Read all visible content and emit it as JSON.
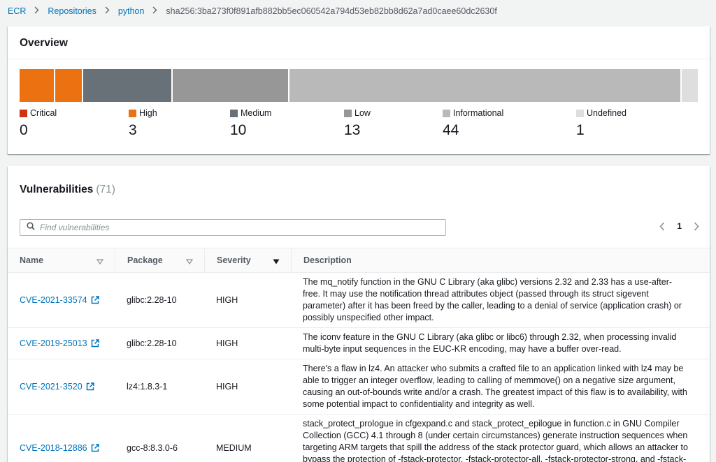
{
  "breadcrumb": {
    "items": [
      "ECR",
      "Repositories",
      "python"
    ],
    "current": "sha256:3ba273f0f891afb882bb5ec060542a794d53eb82bb8d62a7ad0caee60dc2630f"
  },
  "overview": {
    "title": "Overview",
    "segments": [
      {
        "label": "Critical",
        "count": "0",
        "color": "#d13212"
      },
      {
        "label": "High",
        "count": "3",
        "color": "#ec7211"
      },
      {
        "label": "Medium",
        "count": "10",
        "color": "#687078"
      },
      {
        "label": "Low",
        "count": "13",
        "color": "#979797"
      },
      {
        "label": "Informational",
        "count": "44",
        "color": "#b9b9b9"
      },
      {
        "label": "Undefined",
        "count": "1",
        "color": "#dedede"
      }
    ]
  },
  "vulnerabilities": {
    "title": "Vulnerabilities",
    "count": "(71)",
    "search_placeholder": "Find vulnerabilities",
    "page": "1",
    "columns": {
      "name": "Name",
      "package": "Package",
      "severity": "Severity",
      "description": "Description"
    },
    "rows": [
      {
        "name": "CVE-2021-33574",
        "package": "glibc:2.28-10",
        "severity": "HIGH",
        "description": "The mq_notify function in the GNU C Library (aka glibc) versions 2.32 and 2.33 has a use-after-free. It may use the notification thread attributes object (passed through its struct sigevent parameter) after it has been freed by the caller, leading to a denial of service (application crash) or possibly unspecified other impact."
      },
      {
        "name": "CVE-2019-25013",
        "package": "glibc:2.28-10",
        "severity": "HIGH",
        "description": "The iconv feature in the GNU C Library (aka glibc or libc6) through 2.32, when processing invalid multi-byte input sequences in the EUC-KR encoding, may have a buffer over-read."
      },
      {
        "name": "CVE-2021-3520",
        "package": "lz4:1.8.3-1",
        "severity": "HIGH",
        "description": "There's a flaw in lz4. An attacker who submits a crafted file to an application linked with lz4 may be able to trigger an integer overflow, leading to calling of memmove() on a negative size argument, causing an out-of-bounds write and/or a crash. The greatest impact of this flaw is to availability, with some potential impact to confidentiality and integrity as well."
      },
      {
        "name": "CVE-2018-12886",
        "package": "gcc-8:8.3.0-6",
        "severity": "MEDIUM",
        "description": "stack_protect_prologue in cfgexpand.c and stack_protect_epilogue in function.c in GNU Compiler Collection (GCC) 4.1 through 8 (under certain circumstances) generate instruction sequences when targeting ARM targets that spill the address of the stack protector guard, which allows an attacker to bypass the protection of -fstack-protector, -fstack-protector-all, -fstack-protector-strong, and -fstack-protector-explicit against stack overflow by controlling what the stack canary is compared against."
      }
    ]
  }
}
